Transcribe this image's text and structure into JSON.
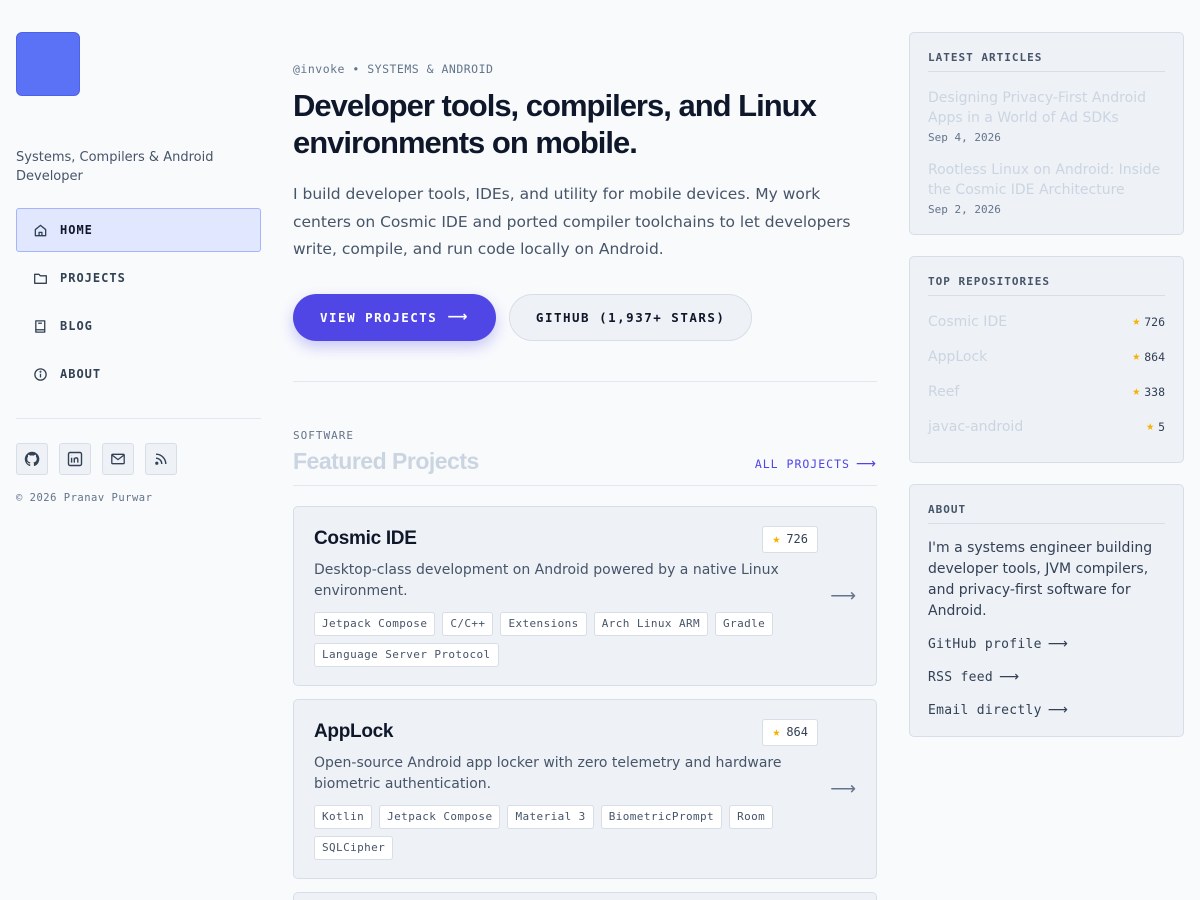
{
  "sidebar": {
    "logo": "logo",
    "tagline": "Systems, Compilers & Android Developer",
    "nav": [
      {
        "label": "HOME",
        "icon": "home-icon",
        "active": true
      },
      {
        "label": "PROJECTS",
        "icon": "folder-icon",
        "active": false
      },
      {
        "label": "BLOG",
        "icon": "book-icon",
        "active": false
      },
      {
        "label": "ABOUT",
        "icon": "info-icon",
        "active": false
      }
    ],
    "socials": [
      "github-icon",
      "linkedin-icon",
      "mail-icon",
      "rss-icon"
    ],
    "copyright": "© 2026 Pranav Purwar"
  },
  "hero": {
    "eyebrow": "@invoke • SYSTEMS & ANDROID",
    "headline": "Developer tools, compilers, and Linux environments on mobile.",
    "lead": "I build developer tools, IDEs, and utility for mobile devices. My work centers on Cosmic IDE and ported compiler toolchains to let developers write, compile, and run code locally on Android.",
    "primary_button": "VIEW PROJECTS",
    "secondary_button": "GITHUB (1,937+ STARS)"
  },
  "featured": {
    "eyebrow": "SOFTWARE",
    "title": "Featured Projects",
    "link": "ALL PROJECTS",
    "projects": [
      {
        "name": "Cosmic IDE",
        "stars": "726",
        "description": "Desktop-class development on Android powered by a native Linux environment.",
        "tags": [
          "Jetpack Compose",
          "C/C++",
          "Extensions",
          "Arch Linux ARM",
          "Gradle",
          "Language Server Protocol"
        ]
      },
      {
        "name": "AppLock",
        "stars": "864",
        "description": "Open-source Android app locker with zero telemetry and hardware biometric authentication.",
        "tags": [
          "Kotlin",
          "Jetpack Compose",
          "Material 3",
          "BiometricPrompt",
          "Room",
          "SQLCipher"
        ]
      }
    ]
  },
  "latest_articles": {
    "title": "LATEST ARTICLES",
    "items": [
      {
        "title": "Designing Privacy-First Android Apps in a World of Ad SDKs",
        "date": "Sep 4, 2026"
      },
      {
        "title": "Rootless Linux on Android: Inside the Cosmic IDE Architecture",
        "date": "Sep 2, 2026"
      }
    ]
  },
  "top_repos": {
    "title": "TOP REPOSITORIES",
    "items": [
      {
        "name": "Cosmic IDE",
        "stars": "726"
      },
      {
        "name": "AppLock",
        "stars": "864"
      },
      {
        "name": "Reef",
        "stars": "338"
      },
      {
        "name": "javac-android",
        "stars": "5"
      }
    ]
  },
  "about": {
    "title": "ABOUT",
    "text": "I'm a systems engineer building developer tools, JVM compilers, and privacy-first software for Android.",
    "links": [
      "GitHub profile",
      "RSS feed",
      "Email directly"
    ]
  },
  "colors": {
    "accent": "#4f46e5",
    "logo": "#5b72f7",
    "star": "#f5b301",
    "active_nav_bg": "#e0e7ff"
  }
}
